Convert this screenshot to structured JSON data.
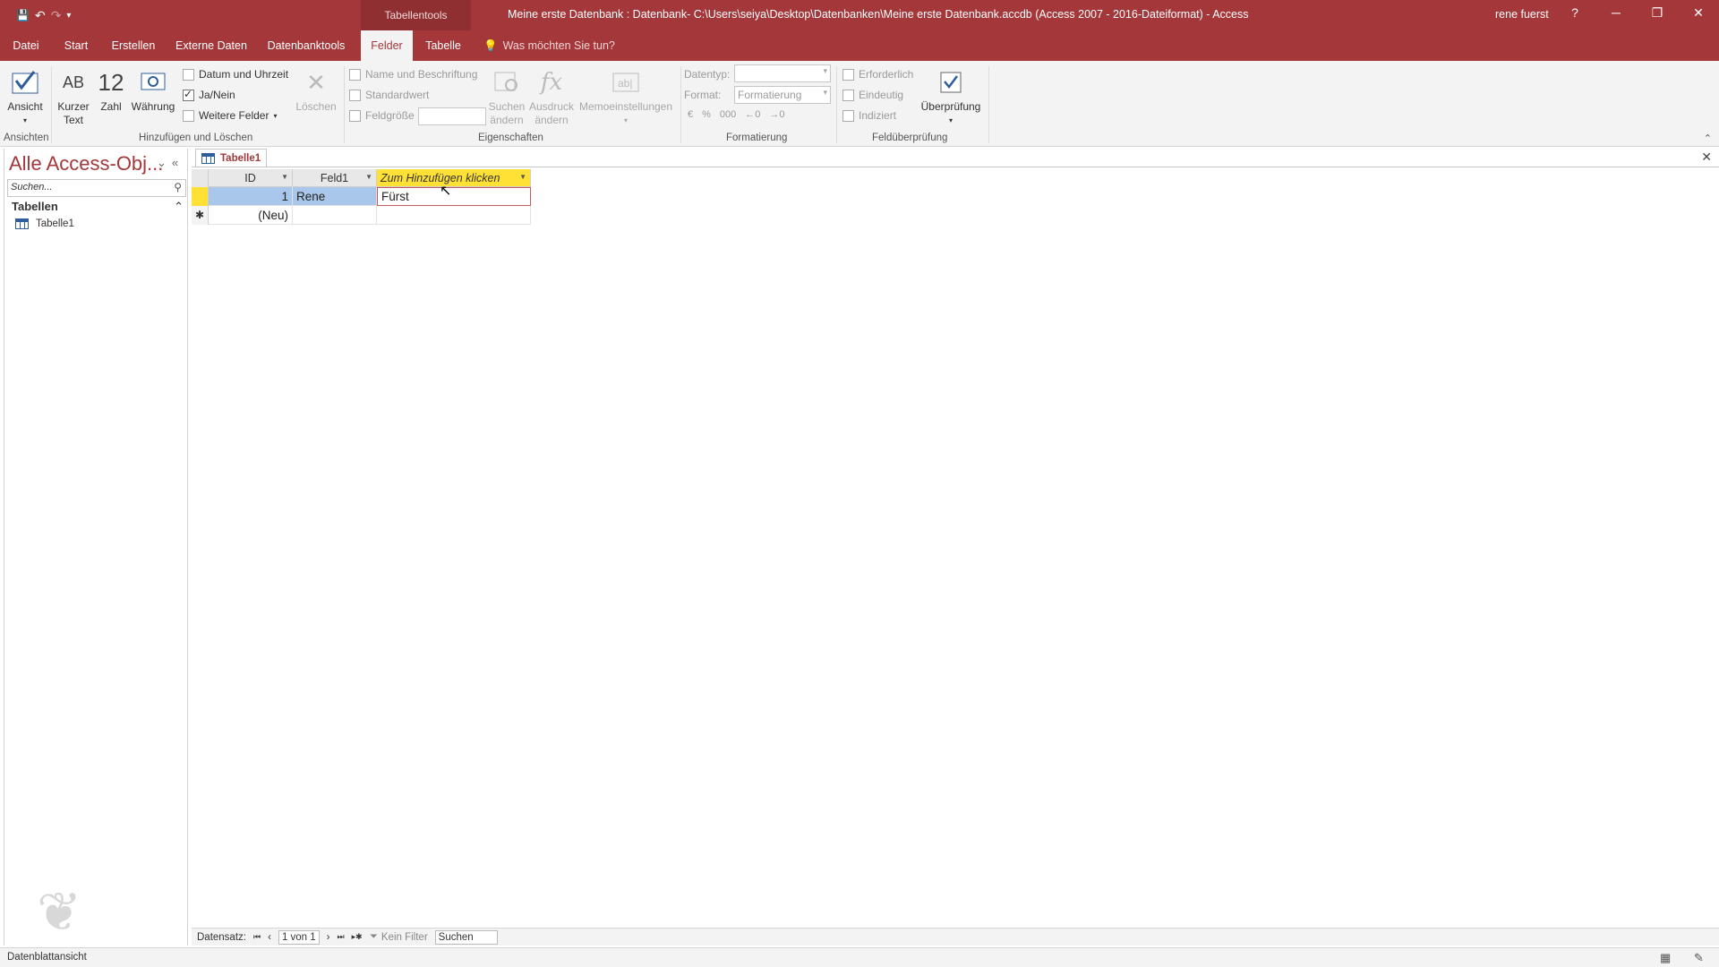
{
  "titlebar": {
    "tools_tab": "Tabellentools",
    "title": "Meine erste Datenbank : Datenbank- C:\\Users\\seiya\\Desktop\\Datenbanken\\Meine erste Datenbank.accdb (Access 2007 - 2016-Dateiformat)  -  Access",
    "user": "rene fuerst",
    "help": "?",
    "minimize": "─",
    "restore": "❐",
    "close": "✕",
    "qat_save": "💾",
    "qat_undo": "↶",
    "qat_redo": "↷",
    "qat_more": "▾"
  },
  "tabs": [
    {
      "label": "Datei"
    },
    {
      "label": "Start"
    },
    {
      "label": "Erstellen"
    },
    {
      "label": "Externe Daten"
    },
    {
      "label": "Datenbanktools"
    },
    {
      "label": "Felder"
    },
    {
      "label": "Tabelle"
    }
  ],
  "tellme": "Was möchten Sie tun?",
  "ribbon": {
    "ansicht": "Ansicht",
    "kurzer_text_icon": "AB",
    "kurzer_text": "Kurzer\nText",
    "zahl_icon": "12",
    "zahl": "Zahl",
    "waehrung": "Währung",
    "datum": "Datum und Uhrzeit",
    "janein": "Ja/Nein",
    "weitere": "Weitere Felder",
    "loeschen": "Löschen",
    "name_beschr": "Name und Beschriftung",
    "standardwert": "Standardwert",
    "feldgroesse": "Feldgröße",
    "suchen_aendern": "Suchen\nändern",
    "ausdruck_aendern": "Ausdruck\nändern",
    "memo": "Memoeinstellungen",
    "datentyp_label": "Datentyp:",
    "format_label": "Format:",
    "format_value": "Formatierung",
    "erforderlich": "Erforderlich",
    "eindeutig": "Eindeutig",
    "indiziert": "Indiziert",
    "ueberpruefung": "Überprüfung",
    "groups": {
      "ansichten": "Ansichten",
      "hinzufuegen": "Hinzufügen und Löschen",
      "eigenschaften": "Eigenschaften",
      "formatierung": "Formatierung",
      "feldueberpruefung": "Feldüberprüfung"
    },
    "collapse": "⌃"
  },
  "nav": {
    "title": "Alle Access-Obj...",
    "search_placeholder": "Suchen...",
    "group": "Tabellen",
    "group_toggle": "⌃",
    "items": [
      {
        "label": "Tabelle1"
      }
    ],
    "menu_btn": "⌄",
    "shutter_btn": "«"
  },
  "doc": {
    "tab_label": "Tabelle1",
    "close": "✕"
  },
  "grid": {
    "columns": [
      {
        "label": "ID"
      },
      {
        "label": "Feld1"
      },
      {
        "label": "Zum Hinzufügen klicken"
      }
    ],
    "rows": [
      {
        "selector": "",
        "id": "1",
        "feld1": "Rene",
        "new": "Fürst"
      },
      {
        "selector": "✱",
        "id": "(Neu)",
        "feld1": "",
        "new": ""
      }
    ]
  },
  "recnav": {
    "label": "Datensatz:",
    "first": "⏮",
    "prev": "‹",
    "position": "1 von 1",
    "next": "›",
    "last": "⏭",
    "new": "▸✱",
    "filter": "Kein Filter",
    "search": "Suchen"
  },
  "status": {
    "text": "Datenblattansicht"
  }
}
